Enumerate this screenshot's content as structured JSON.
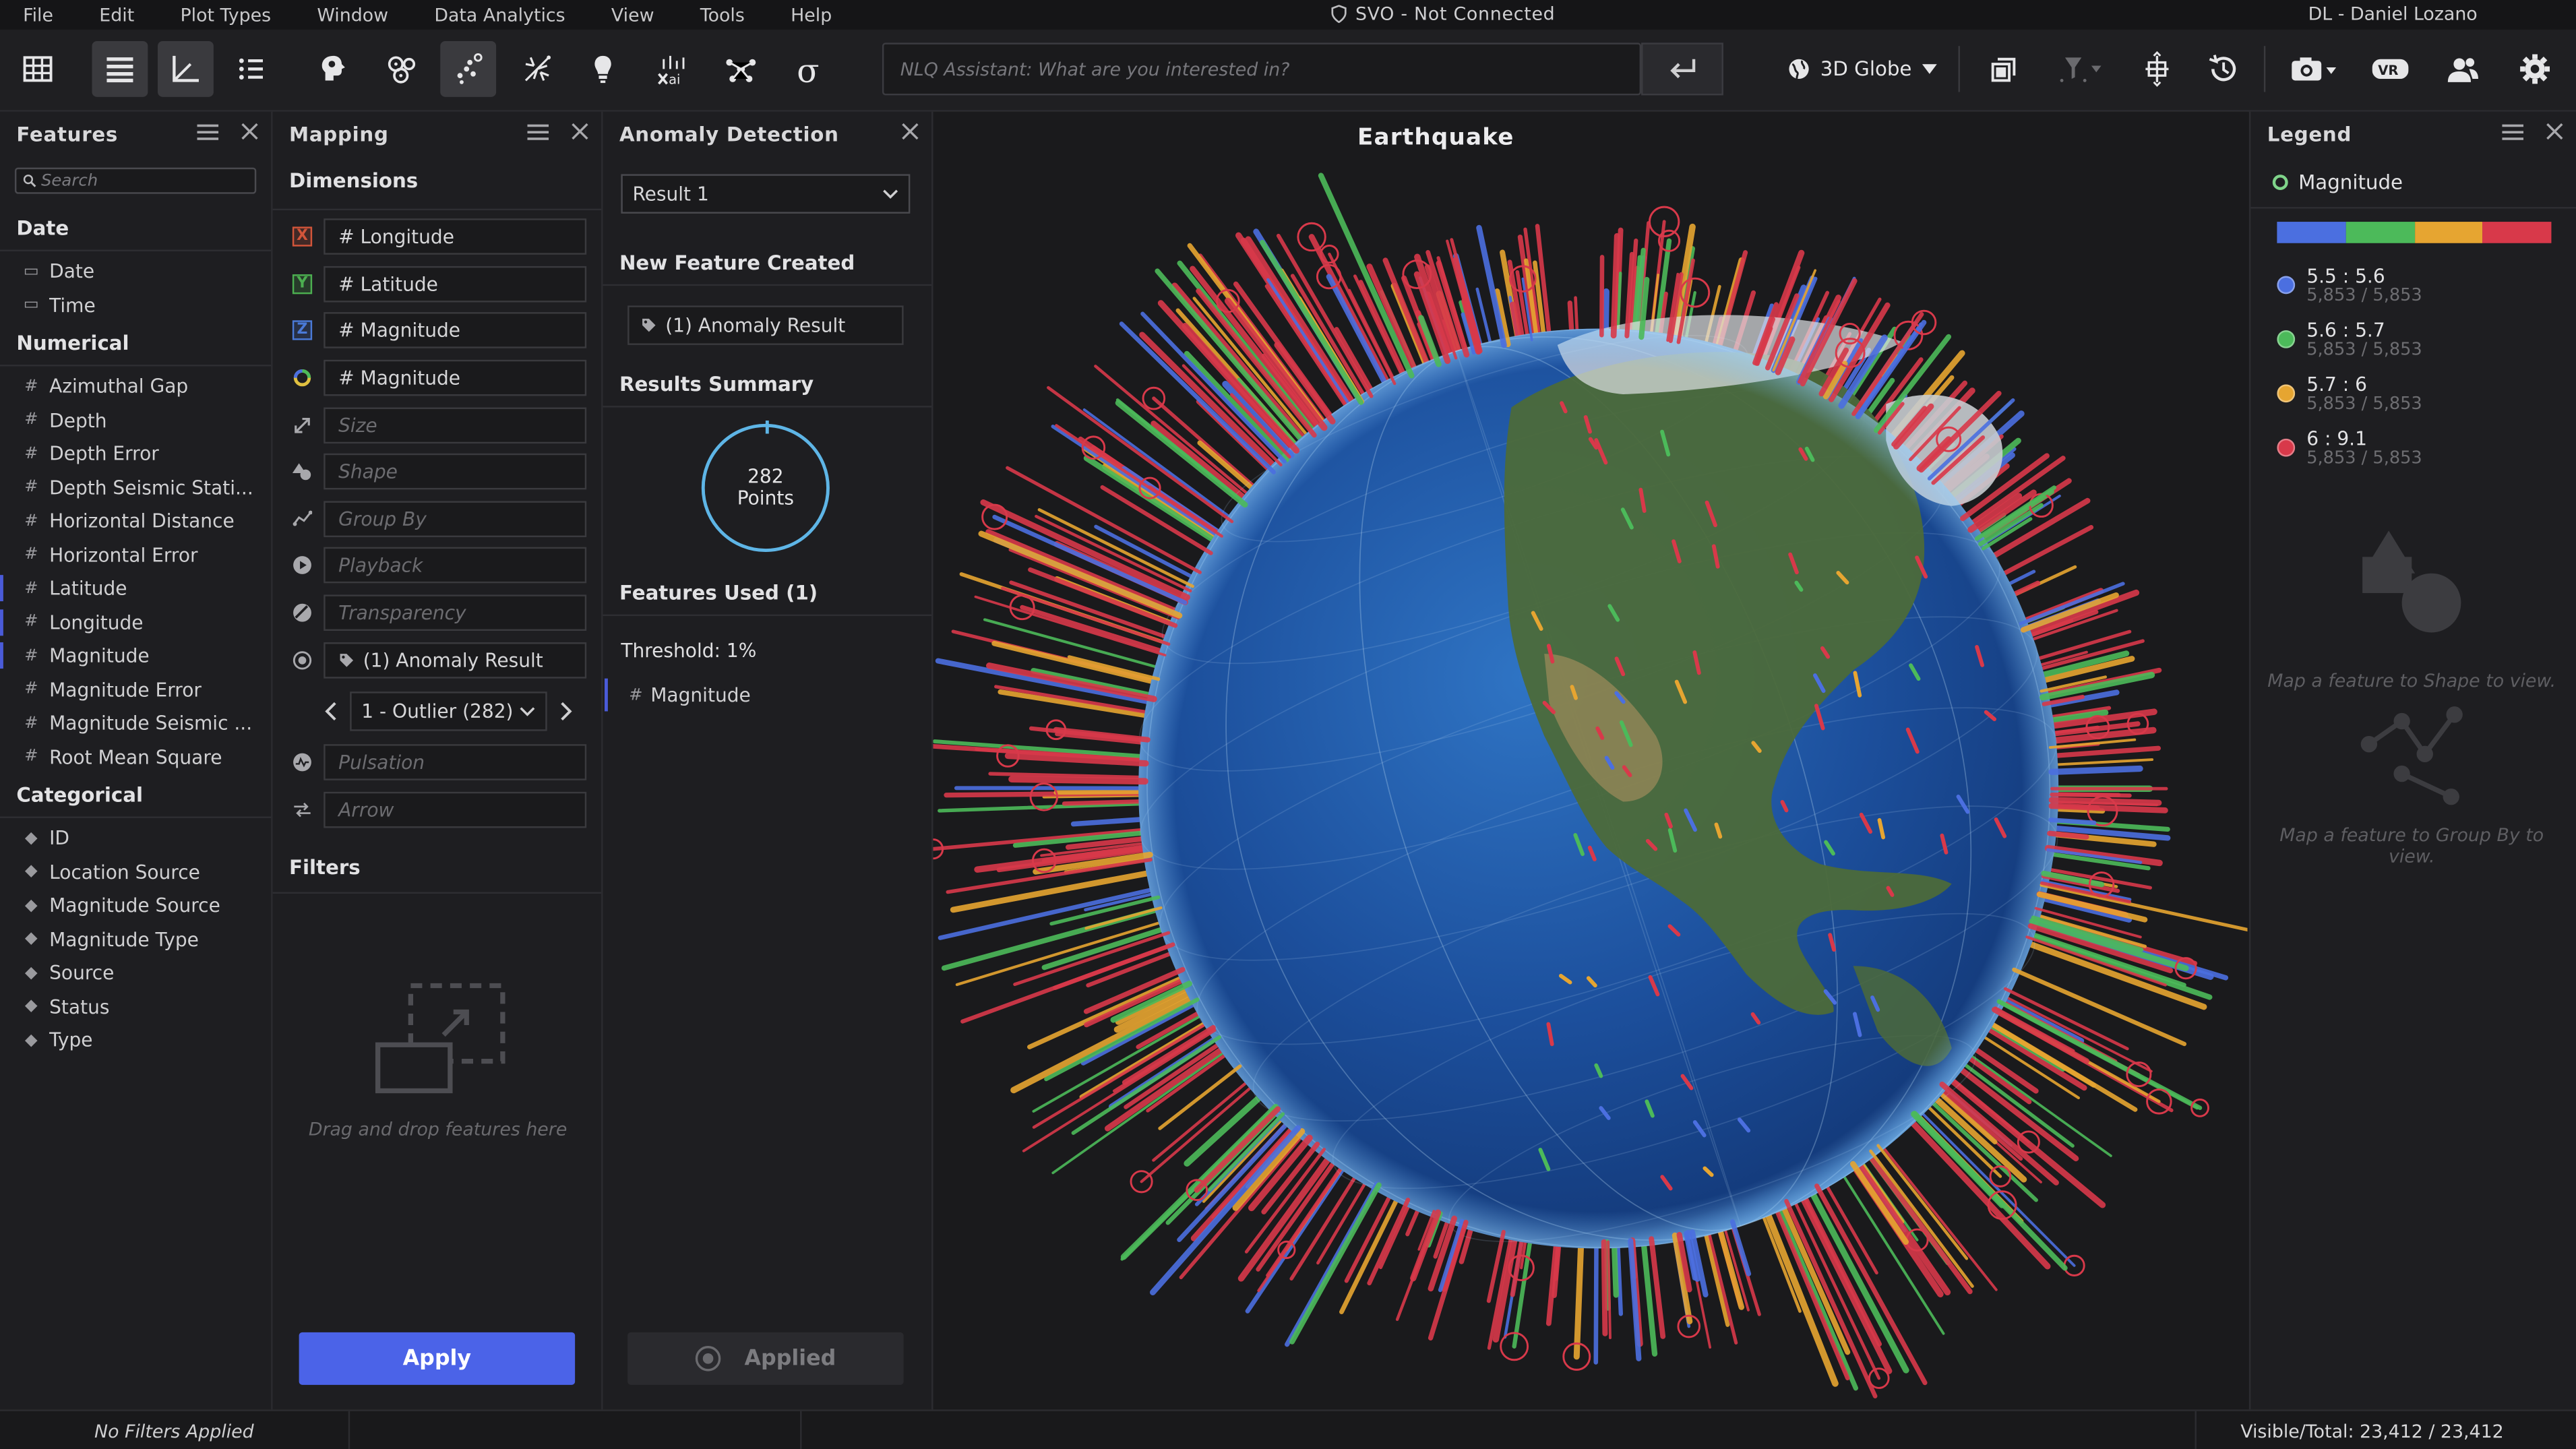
{
  "menu": [
    "File",
    "Edit",
    "Plot Types",
    "Window",
    "Data Analytics",
    "View",
    "Tools",
    "Help"
  ],
  "connection_status": "SVO - Not Connected",
  "user": "DL - Daniel Lozano",
  "toolbar": {
    "nlq_placeholder": "NLQ Assistant: What are you interested in?",
    "view_mode": "3D Globe",
    "icons": [
      "table-icon",
      "list-view-icon",
      "axis-chart-icon",
      "bullet-list-icon",
      "brain-icon",
      "cluster-icon",
      "scatter-icon",
      "fireworks-icon",
      "lightbulb-icon",
      "xai-icon",
      "network-icon",
      "sigma-icon",
      "globe-icon",
      "layers-icon",
      "filter-pin-icon",
      "transform-icon",
      "history-icon",
      "camera-icon",
      "vr-icon",
      "users-icon",
      "gear-icon"
    ]
  },
  "features_panel": {
    "title": "Features",
    "search_placeholder": "Search",
    "groups": [
      {
        "name": "Date",
        "items": [
          {
            "label": "Date",
            "icon": "calendar-icon"
          },
          {
            "label": "Time",
            "icon": "calendar-icon"
          }
        ]
      },
      {
        "name": "Numerical",
        "items": [
          {
            "label": "Azimuthal Gap",
            "icon": "hash-icon"
          },
          {
            "label": "Depth",
            "icon": "hash-icon"
          },
          {
            "label": "Depth Error",
            "icon": "hash-icon"
          },
          {
            "label": "Depth Seismic Stati...",
            "icon": "hash-icon"
          },
          {
            "label": "Horizontal Distance",
            "icon": "hash-icon"
          },
          {
            "label": "Horizontal Error",
            "icon": "hash-icon"
          },
          {
            "label": "Latitude",
            "icon": "hash-icon"
          },
          {
            "label": "Longitude",
            "icon": "hash-icon"
          },
          {
            "label": "Magnitude",
            "icon": "hash-icon"
          },
          {
            "label": "Magnitude Error",
            "icon": "hash-icon"
          },
          {
            "label": "Magnitude Seismic ...",
            "icon": "hash-icon"
          },
          {
            "label": "Root Mean Square",
            "icon": "hash-icon"
          }
        ]
      },
      {
        "name": "Categorical",
        "items": [
          {
            "label": "ID",
            "icon": "tag-icon"
          },
          {
            "label": "Location Source",
            "icon": "tag-icon"
          },
          {
            "label": "Magnitude Source",
            "icon": "tag-icon"
          },
          {
            "label": "Magnitude Type",
            "icon": "tag-icon"
          },
          {
            "label": "Source",
            "icon": "tag-icon"
          },
          {
            "label": "Status",
            "icon": "tag-icon"
          },
          {
            "label": "Type",
            "icon": "tag-icon"
          }
        ]
      }
    ]
  },
  "mapping_panel": {
    "title": "Mapping",
    "dimensions_label": "Dimensions",
    "rows": [
      {
        "dim": "X",
        "value": "# Longitude",
        "empty": false
      },
      {
        "dim": "Y",
        "value": "# Latitude",
        "empty": false
      },
      {
        "dim": "Z",
        "value": "# Magnitude",
        "empty": false
      },
      {
        "dim": "color",
        "value": "# Magnitude",
        "empty": false
      },
      {
        "dim": "size",
        "value": "Size",
        "empty": true
      },
      {
        "dim": "shape",
        "value": "Shape",
        "empty": true
      },
      {
        "dim": "group",
        "value": "Group By",
        "empty": true
      },
      {
        "dim": "playback",
        "value": "Playback",
        "empty": true
      },
      {
        "dim": "transparency",
        "value": "Transparency",
        "empty": true
      },
      {
        "dim": "visibility",
        "value": "(1) Anomaly Result",
        "empty": false
      }
    ],
    "outlier_select": "1 - Outlier (282)",
    "rows_after": [
      {
        "dim": "pulsation",
        "value": "Pulsation",
        "empty": true
      },
      {
        "dim": "arrow",
        "value": "Arrow",
        "empty": true
      }
    ],
    "filters_label": "Filters",
    "dropzone_text": "Drag and drop features here",
    "apply_label": "Apply"
  },
  "anomaly_panel": {
    "title": "Anomaly Detection",
    "result_select": "Result 1",
    "new_feature_label": "New Feature Created",
    "new_feature_value": "(1) Anomaly Result",
    "results_summary_label": "Results Summary",
    "points_count": "282",
    "points_label": "Points",
    "features_used_label": "Features Used (1)",
    "threshold": "Threshold: 1%",
    "feature_used": "Magnitude",
    "applied_label": "Applied"
  },
  "viz": {
    "title": "Earthquake"
  },
  "legend_panel": {
    "title": "Legend",
    "feature": "Magnitude",
    "bar_colors": [
      "#4b6fe0",
      "#4cba5a",
      "#e6a531",
      "#d8394a"
    ],
    "items": [
      {
        "range": "5.5 : 5.6",
        "count": "5,853 / 5,853",
        "color": "#4b6fe0"
      },
      {
        "range": "5.6 : 5.7",
        "count": "5,853 / 5,853",
        "color": "#4cba5a"
      },
      {
        "range": "5.7 : 6",
        "count": "5,853 / 5,853",
        "color": "#e6a531"
      },
      {
        "range": "6 : 9.1",
        "count": "5,853 / 5,853",
        "color": "#d8394a"
      }
    ],
    "shape_hint": "Map a feature to Shape to view.",
    "group_hint": "Map a feature to Group By to view."
  },
  "statusbar": {
    "filters": "No Filters Applied",
    "visible_total": "Visible/Total: 23,412 / 23,412"
  }
}
